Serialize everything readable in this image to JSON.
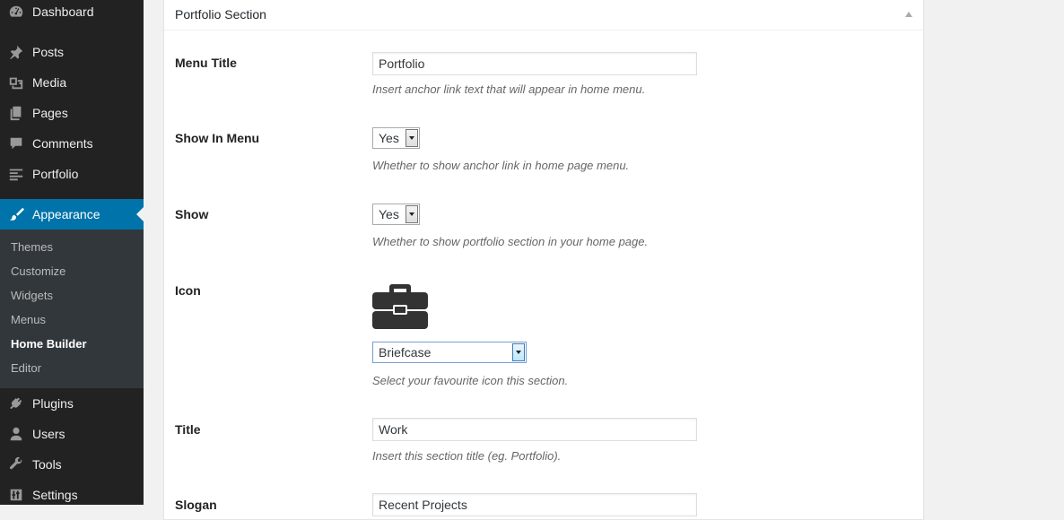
{
  "sidebar": {
    "items": [
      {
        "label": "Dashboard",
        "icon": "dashboard-icon"
      },
      {
        "label": "Posts",
        "icon": "pin-icon"
      },
      {
        "label": "Media",
        "icon": "media-icon"
      },
      {
        "label": "Pages",
        "icon": "pages-icon"
      },
      {
        "label": "Comments",
        "icon": "comment-icon"
      },
      {
        "label": "Portfolio",
        "icon": "portfolio-icon"
      },
      {
        "label": "Appearance",
        "icon": "paintbrush-icon"
      },
      {
        "label": "Plugins",
        "icon": "plugin-icon"
      },
      {
        "label": "Users",
        "icon": "users-icon"
      },
      {
        "label": "Tools",
        "icon": "wrench-icon"
      },
      {
        "label": "Settings",
        "icon": "settings-icon"
      }
    ],
    "submenu": [
      "Themes",
      "Customize",
      "Widgets",
      "Menus",
      "Home Builder",
      "Editor"
    ],
    "active_submenu": "Home Builder",
    "accent_color": "#0073aa"
  },
  "section": {
    "title": "Portfolio Section"
  },
  "fields": {
    "menu_title": {
      "label": "Menu Title",
      "value": "Portfolio",
      "description": "Insert anchor link text that will appear in home menu."
    },
    "show_in_menu": {
      "label": "Show In Menu",
      "value": "Yes",
      "description": "Whether to show anchor link in home page menu."
    },
    "show": {
      "label": "Show",
      "value": "Yes",
      "description": "Whether to show portfolio section in your home page."
    },
    "icon": {
      "label": "Icon",
      "preview_icon": "briefcase-icon",
      "value": "Briefcase",
      "description": "Select your favourite icon this section."
    },
    "title": {
      "label": "Title",
      "value": "Work",
      "description": "Insert this section title (eg. Portfolio)."
    },
    "slogan": {
      "label": "Slogan",
      "value": "Recent Projects"
    }
  }
}
